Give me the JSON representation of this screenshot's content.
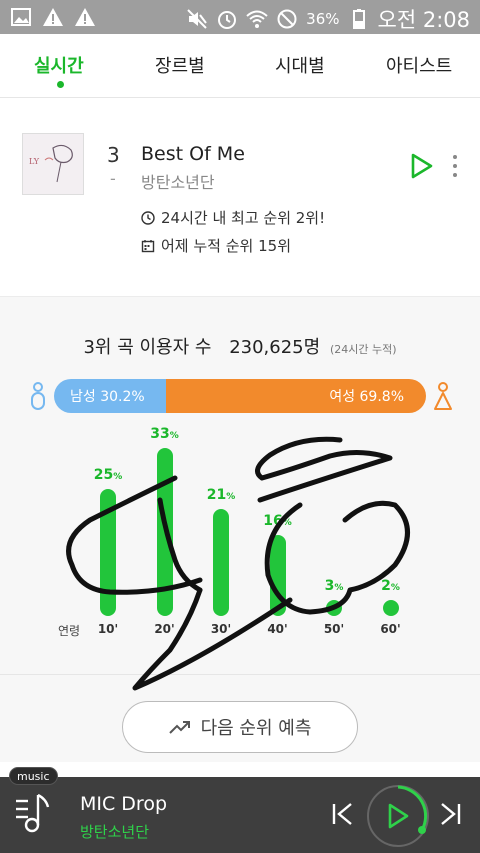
{
  "status_bar": {
    "battery": "36%",
    "time": "오전 2:08",
    "icons": [
      "image-icon",
      "warning-icon",
      "warning-icon",
      "mute-icon",
      "alarm-icon",
      "wifi-icon",
      "block-icon",
      "battery-icon"
    ]
  },
  "tabs": [
    {
      "label": "실시간",
      "active": true
    },
    {
      "label": "장르별",
      "active": false
    },
    {
      "label": "시대별",
      "active": false
    },
    {
      "label": "아티스트",
      "active": false
    }
  ],
  "song": {
    "rank": "3",
    "rank_change": "-",
    "title": "Best Of Me",
    "artist": "방탄소년단",
    "info_peak": "24시간 내 최고 순위 2위!",
    "info_cumulative": "어제 누적 순위 15위"
  },
  "stats": {
    "users_label": "3위 곡 이용자 수",
    "users_count": "230,625명",
    "users_note": "(24시간 누적)",
    "male_label": "남성 30.2%",
    "female_label": "여성 69.8%",
    "male_ratio": 0.302,
    "age_axis_title": "연령",
    "age_groups": [
      {
        "tick": "10'",
        "value": 25,
        "label": "25",
        "unit": "%"
      },
      {
        "tick": "20'",
        "value": 33,
        "label": "33",
        "unit": "%"
      },
      {
        "tick": "30'",
        "value": 21,
        "label": "21",
        "unit": "%"
      },
      {
        "tick": "40'",
        "value": 16,
        "label": "16",
        "unit": "%"
      },
      {
        "tick": "50'",
        "value": 3,
        "label": "3",
        "unit": "%"
      },
      {
        "tick": "60'",
        "value": 2,
        "label": "2",
        "unit": "%"
      }
    ],
    "predict_button": "다음 순위 예측"
  },
  "player": {
    "tag": "music",
    "title": "MIC Drop",
    "artist": "방탄소년단"
  },
  "colors": {
    "accent_green": "#1bb72b",
    "male_blue": "#76b8f0",
    "female_orange": "#f28a2c",
    "player_bg": "#3e3e3e"
  }
}
